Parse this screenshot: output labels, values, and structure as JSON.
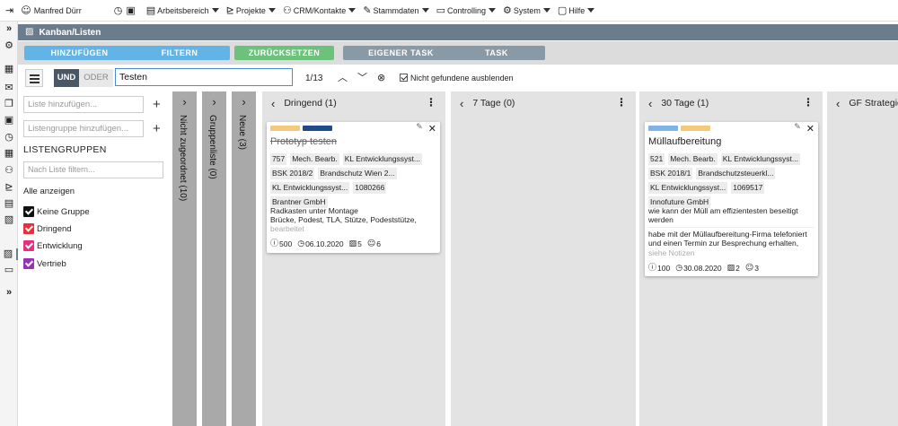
{
  "topbar": {
    "user": "Manfred Dürr",
    "menus": [
      "Arbeitsbereich",
      "Projekte",
      "CRM/Kontakte",
      "Stammdaten",
      "Controlling",
      "System",
      "Hilfe"
    ]
  },
  "title": "Kanban/Listen",
  "buttons": {
    "add": "HINZUFÜGEN",
    "filter": "FILTERN",
    "reset": "ZURÜCKSETZEN",
    "own_task": "EIGENER TASK",
    "task": "TASK"
  },
  "filterbar": {
    "und": "UND",
    "oder": "ODER",
    "search_value": "Testen",
    "counter": "1/13",
    "hide_label": "Nicht gefundene ausblenden"
  },
  "sidepanel": {
    "add_list_placeholder": "Liste hinzufügen...",
    "add_group_placeholder": "Listengruppe hinzufügen...",
    "groups_heading": "LISTENGRUPPEN",
    "filter_placeholder": "Nach Liste filtern...",
    "show_all": "Alle anzeigen",
    "groups": [
      {
        "label": "Keine Gruppe",
        "color": "#111111"
      },
      {
        "label": "Dringend",
        "color": "#e8303c"
      },
      {
        "label": "Entwicklung",
        "color": "#e8307a"
      },
      {
        "label": "Vertrieb",
        "color": "#9b30b8"
      }
    ]
  },
  "collapsed_columns": [
    "Nicht zugeordnet (10)",
    "Gruppenliste (0)",
    "Neue (3)"
  ],
  "lanes": [
    {
      "title": "Dringend (1)"
    },
    {
      "title": "7 Tage (0)"
    },
    {
      "title": "30 Tage (1)"
    },
    {
      "title": "GF Strategie"
    }
  ],
  "cards": [
    {
      "title": "Prototyp testen",
      "bars": [
        "#f5c97a",
        "#1f4a8c"
      ],
      "tags": [
        "757",
        "Mech. Bearb.",
        "KL Entwicklungssyst...",
        "BSK 2018/2",
        "Brandschutz Wien 2...",
        "KL Entwicklungssyst...",
        "1080266",
        "Brantner GmbH"
      ],
      "desc1": "Radkasten unter Montage",
      "desc2": "Brücke, Podest, TLA, Stütze, Podeststütze,",
      "desc3": "bearbeitet",
      "hours": "500",
      "date": "06.10.2020",
      "tasks": "5",
      "users": "6"
    },
    {
      "title": "Müllaufbereitung",
      "bars": [
        "#7fb3e8",
        "#f5c97a"
      ],
      "tags": [
        "521",
        "Mech. Bearb.",
        "KL Entwicklungssyst...",
        "BSK 2018/1",
        "Brandschutzsteuerkl...",
        "KL Entwicklungssyst...",
        "1069517",
        "Innofuture GmbH"
      ],
      "desc1": "wie kann der Müll am effizientesten beseitigt werden",
      "desc2": "habe mit der Müllaufbereitung-Firma telefoniert und einen Termin zur Besprechung erhalten,",
      "desc3": "siehe Notizen",
      "hours": "100",
      "date": "30.08.2020",
      "tasks": "2",
      "users": "3"
    }
  ],
  "colors": {
    "title_bar": "#6b7d8c",
    "btn_blue": "#62b3e6",
    "btn_green": "#6cc27a",
    "btn_gray": "#8a99a6",
    "und": "#4a5866",
    "lane_bg": "#e3e3e3",
    "collapsed_bg": "#a9a9a9"
  }
}
